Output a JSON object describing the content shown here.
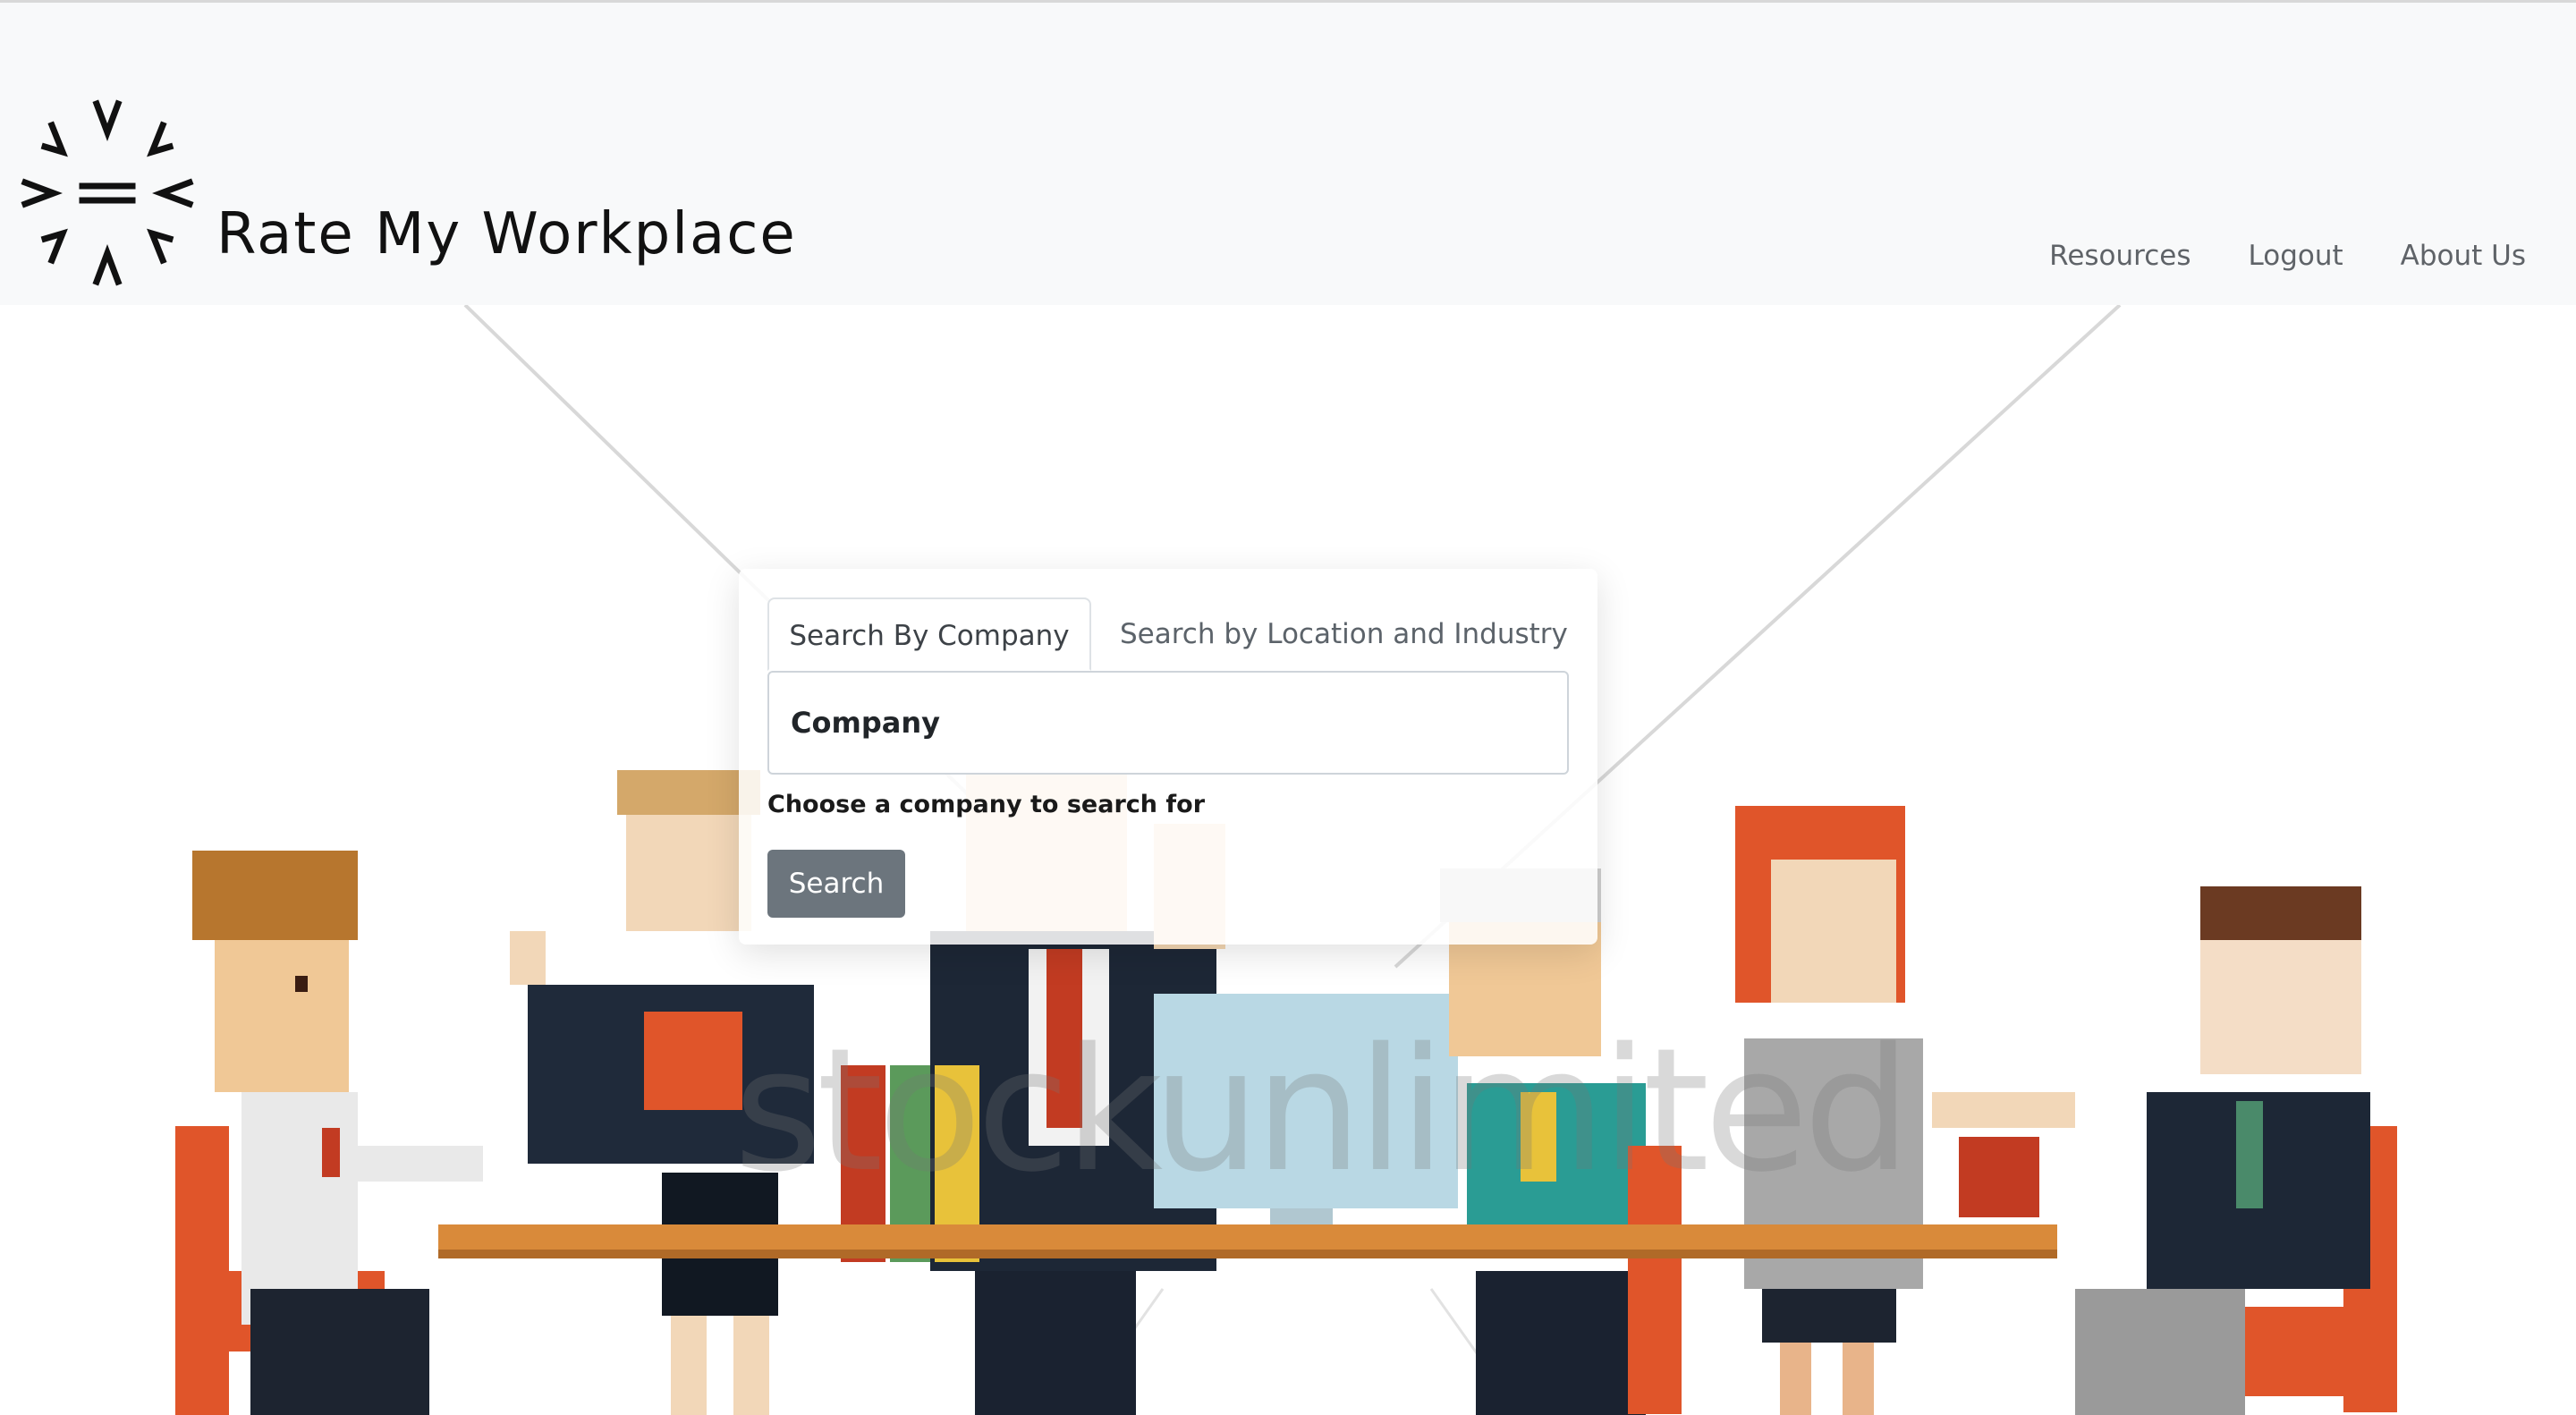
{
  "navbar": {
    "brand": "Rate My Workplace",
    "links": [
      "Resources",
      "Logout",
      "About Us"
    ]
  },
  "hero": {
    "watermark": "stockunlimited"
  },
  "search_card": {
    "tabs": [
      "Search By Company",
      "Search by Location and Industry"
    ],
    "active_tab": "Search By Company",
    "company_field_placeholder": "Company",
    "helper_text": "Choose a company to search for",
    "search_button": "Search"
  },
  "colors": {
    "navbar_bg": "#f8f9fa",
    "button_bg": "#6c757d",
    "nav_link": "#5f6368",
    "chair_orange": "#e0552a",
    "table_wood": "#d98a3a"
  },
  "icons": [
    "rate-my-workplace-logo-icon"
  ]
}
